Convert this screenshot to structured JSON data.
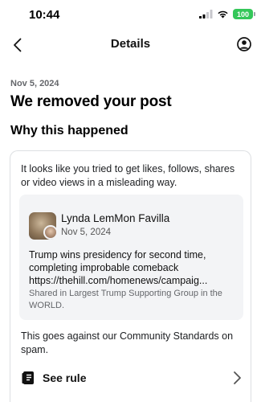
{
  "status_bar": {
    "time": "10:44",
    "battery": "100"
  },
  "nav": {
    "title": "Details",
    "back_icon": "chevron-left-icon",
    "account_icon": "account-circle-icon"
  },
  "page": {
    "date": "Nov 5, 2024",
    "headline": "We removed your post",
    "subheading": "Why this happened"
  },
  "card": {
    "intro": "It looks like you tried to get likes, follows, shares or video views in a misleading way.",
    "post": {
      "author": "Lynda LemMon Favilla",
      "date": "Nov 5, 2024",
      "body_line1": "Trump wins presidency for second time,",
      "body_line2": "completing improbable comeback",
      "body_link": "https://thehill.com/homenews/campaig...",
      "shared_in": "Shared in Largest Trump Supporting Group in the WORLD."
    },
    "standards_text": "This goes against our Community Standards on spam.",
    "see_rule_label": "See rule"
  },
  "colors": {
    "battery": "#34c759",
    "text": "#1c1e21",
    "muted": "#65676b",
    "post_bg": "#f3f4f6"
  }
}
